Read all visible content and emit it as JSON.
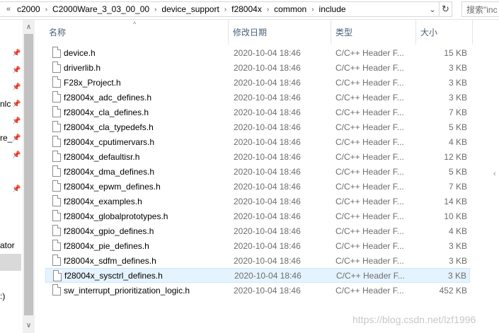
{
  "address_bar": {
    "overflow": "«",
    "crumbs": [
      "c2000",
      "C2000Ware_3_03_00_00",
      "device_support",
      "f28004x",
      "common",
      "include"
    ],
    "separator": "›",
    "dropdown": "⌄",
    "refresh": "↻"
  },
  "search": {
    "placeholder": "搜索\"inc"
  },
  "nav": {
    "pins": [
      "📌",
      "📌",
      "📌",
      "📌",
      "📌",
      "📌",
      "📌",
      "📌"
    ],
    "texts": [
      "nlc",
      "re_",
      "ator",
      ":)"
    ],
    "scroll_up": "∧",
    "scroll_down": "∨"
  },
  "columns": {
    "name": "名称",
    "date": "修改日期",
    "type": "类型",
    "size": "大小",
    "sort_indicator": "^"
  },
  "files": [
    {
      "name": "device.h",
      "date": "2020-10-04 18:46",
      "type": "C/C++ Header F...",
      "size": "15 KB"
    },
    {
      "name": "driverlib.h",
      "date": "2020-10-04 18:46",
      "type": "C/C++ Header F...",
      "size": "3 KB"
    },
    {
      "name": "F28x_Project.h",
      "date": "2020-10-04 18:46",
      "type": "C/C++ Header F...",
      "size": "3 KB"
    },
    {
      "name": "f28004x_adc_defines.h",
      "date": "2020-10-04 18:46",
      "type": "C/C++ Header F...",
      "size": "3 KB"
    },
    {
      "name": "f28004x_cla_defines.h",
      "date": "2020-10-04 18:46",
      "type": "C/C++ Header F...",
      "size": "7 KB"
    },
    {
      "name": "f28004x_cla_typedefs.h",
      "date": "2020-10-04 18:46",
      "type": "C/C++ Header F...",
      "size": "5 KB"
    },
    {
      "name": "f28004x_cputimervars.h",
      "date": "2020-10-04 18:46",
      "type": "C/C++ Header F...",
      "size": "4 KB"
    },
    {
      "name": "f28004x_defaultisr.h",
      "date": "2020-10-04 18:46",
      "type": "C/C++ Header F...",
      "size": "12 KB"
    },
    {
      "name": "f28004x_dma_defines.h",
      "date": "2020-10-04 18:46",
      "type": "C/C++ Header F...",
      "size": "5 KB"
    },
    {
      "name": "f28004x_epwm_defines.h",
      "date": "2020-10-04 18:46",
      "type": "C/C++ Header F...",
      "size": "7 KB"
    },
    {
      "name": "f28004x_examples.h",
      "date": "2020-10-04 18:46",
      "type": "C/C++ Header F...",
      "size": "14 KB"
    },
    {
      "name": "f28004x_globalprototypes.h",
      "date": "2020-10-04 18:46",
      "type": "C/C++ Header F...",
      "size": "10 KB"
    },
    {
      "name": "f28004x_gpio_defines.h",
      "date": "2020-10-04 18:46",
      "type": "C/C++ Header F...",
      "size": "4 KB"
    },
    {
      "name": "f28004x_pie_defines.h",
      "date": "2020-10-04 18:46",
      "type": "C/C++ Header F...",
      "size": "3 KB"
    },
    {
      "name": "f28004x_sdfm_defines.h",
      "date": "2020-10-04 18:46",
      "type": "C/C++ Header F...",
      "size": "3 KB"
    },
    {
      "name": "f28004x_sysctrl_defines.h",
      "date": "2020-10-04 18:46",
      "type": "C/C++ Header F...",
      "size": "3 KB",
      "selected": true
    },
    {
      "name": "sw_interrupt_prioritization_logic.h",
      "date": "2020-10-04 18:46",
      "type": "C/C++ Header F...",
      "size": "452 KB"
    }
  ],
  "right_edge": "‹",
  "watermark": "https://blog.csdn.net/lzf1996"
}
